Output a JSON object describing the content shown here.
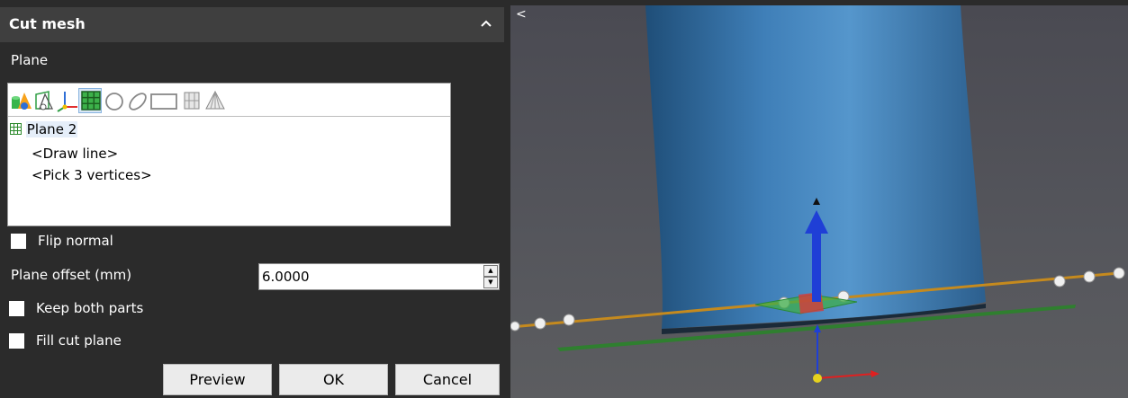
{
  "panel": {
    "title": "Cut mesh",
    "collapse_icon": "chevron-up-icon",
    "plane_section_label": "Plane",
    "toolbar_icons": [
      "primitive-shapes-icon",
      "cone-plane-icon",
      "coordinate-axes-icon",
      "plane-grid-icon",
      "circle-icon",
      "ellipse-icon",
      "rectangle-icon",
      "cylinder-icon",
      "cone-icon"
    ],
    "tree_items": {
      "plane2": "Plane 2",
      "draw_line": "<Draw line>",
      "pick_vertices": "<Pick 3 vertices>"
    },
    "flip_normal": {
      "label": "Flip normal",
      "checked": false
    },
    "plane_offset": {
      "label": "Plane offset (mm)",
      "value": "6.0000"
    },
    "keep_both_parts": {
      "label": "Keep both parts",
      "checked": false
    },
    "fill_cut_plane": {
      "label": "Fill cut plane",
      "checked": false
    },
    "buttons": {
      "preview": "Preview",
      "ok": "OK",
      "cancel": "Cancel"
    }
  },
  "viewport": {
    "toggle_icon": "chevron-left-icon",
    "toggle_glyph": "<",
    "colors": {
      "mesh": "#3b78ad",
      "cut_line": "#c58a1e",
      "plane_outline": "#2e8b2e",
      "axis_z": "#1f3fd6",
      "axis_x": "#e02020",
      "axis_y": "#20b020"
    }
  }
}
